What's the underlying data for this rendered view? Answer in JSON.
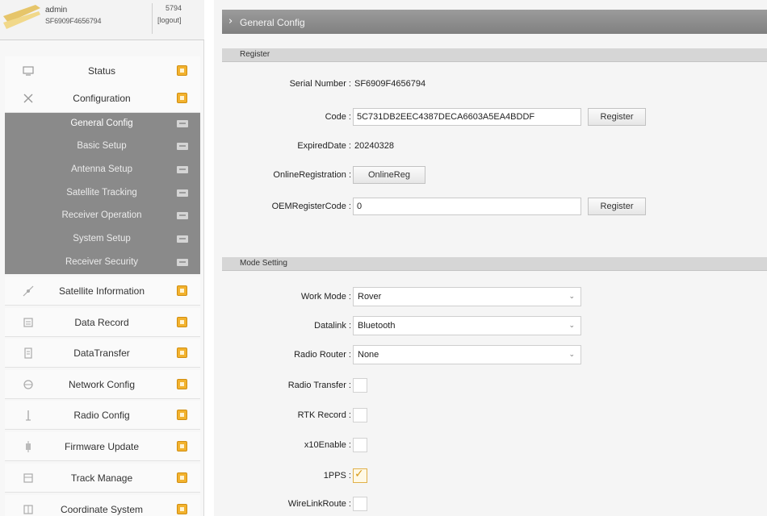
{
  "user": {
    "name": "admin",
    "serial": "SF6909F4656794",
    "id_short": "5794",
    "logout": "[logout]"
  },
  "sidebar": {
    "items": [
      {
        "label": "Status",
        "icon": "monitor-icon"
      },
      {
        "label": "Configuration",
        "icon": "wrench-icon"
      },
      {
        "label": "Satellite Information",
        "icon": "satellite-icon"
      },
      {
        "label": "Data Record",
        "icon": "record-icon"
      },
      {
        "label": "DataTransfer",
        "icon": "transfer-icon"
      },
      {
        "label": "Network Config",
        "icon": "network-icon"
      },
      {
        "label": "Radio Config",
        "icon": "radio-icon"
      },
      {
        "label": "Firmware Update",
        "icon": "firmware-icon"
      },
      {
        "label": "Track Manage",
        "icon": "track-icon"
      },
      {
        "label": "Coordinate System",
        "icon": "coordinate-icon"
      }
    ],
    "submenu": [
      {
        "label": "General Config",
        "active": true
      },
      {
        "label": "Basic Setup"
      },
      {
        "label": "Antenna Setup"
      },
      {
        "label": "Satellite Tracking"
      },
      {
        "label": "Receiver Operation"
      },
      {
        "label": "System Setup"
      },
      {
        "label": "Receiver Security"
      }
    ]
  },
  "main": {
    "title": "General Config",
    "register": {
      "heading": "Register",
      "serial_label": "Serial Number :",
      "serial_value": "SF6909F4656794",
      "code_label": "Code :",
      "code_value": "5C731DB2EEC4387DECA6603A5EA4BDDF",
      "register_button": "Register",
      "expired_label": "ExpiredDate :",
      "expired_value": "20240328",
      "online_label": "OnlineRegistration :",
      "online_button": "OnlineReg",
      "oem_label": "OEMRegisterCode :",
      "oem_value": "0",
      "oem_button": "Register"
    },
    "mode": {
      "heading": "Mode Setting",
      "work_mode_label": "Work Mode :",
      "work_mode_value": "Rover",
      "datalink_label": "Datalink :",
      "datalink_value": "Bluetooth",
      "radio_router_label": "Radio Router :",
      "radio_router_value": "None",
      "radio_transfer_label": "Radio Transfer :",
      "radio_transfer_checked": false,
      "rtk_record_label": "RTK Record :",
      "rtk_record_checked": false,
      "x_label": "x10Enable :",
      "x_checked": false,
      "pps_label": "1PPS :",
      "pps_checked": true,
      "wirelink_label": "WireLinkRoute :",
      "wirelink_checked": false
    }
  },
  "colors": {
    "badge": "#f2b22e",
    "submenu_bg": "#8a8a8a",
    "title_bar": "#8c8c8c",
    "section_head": "#d6d6d6"
  }
}
